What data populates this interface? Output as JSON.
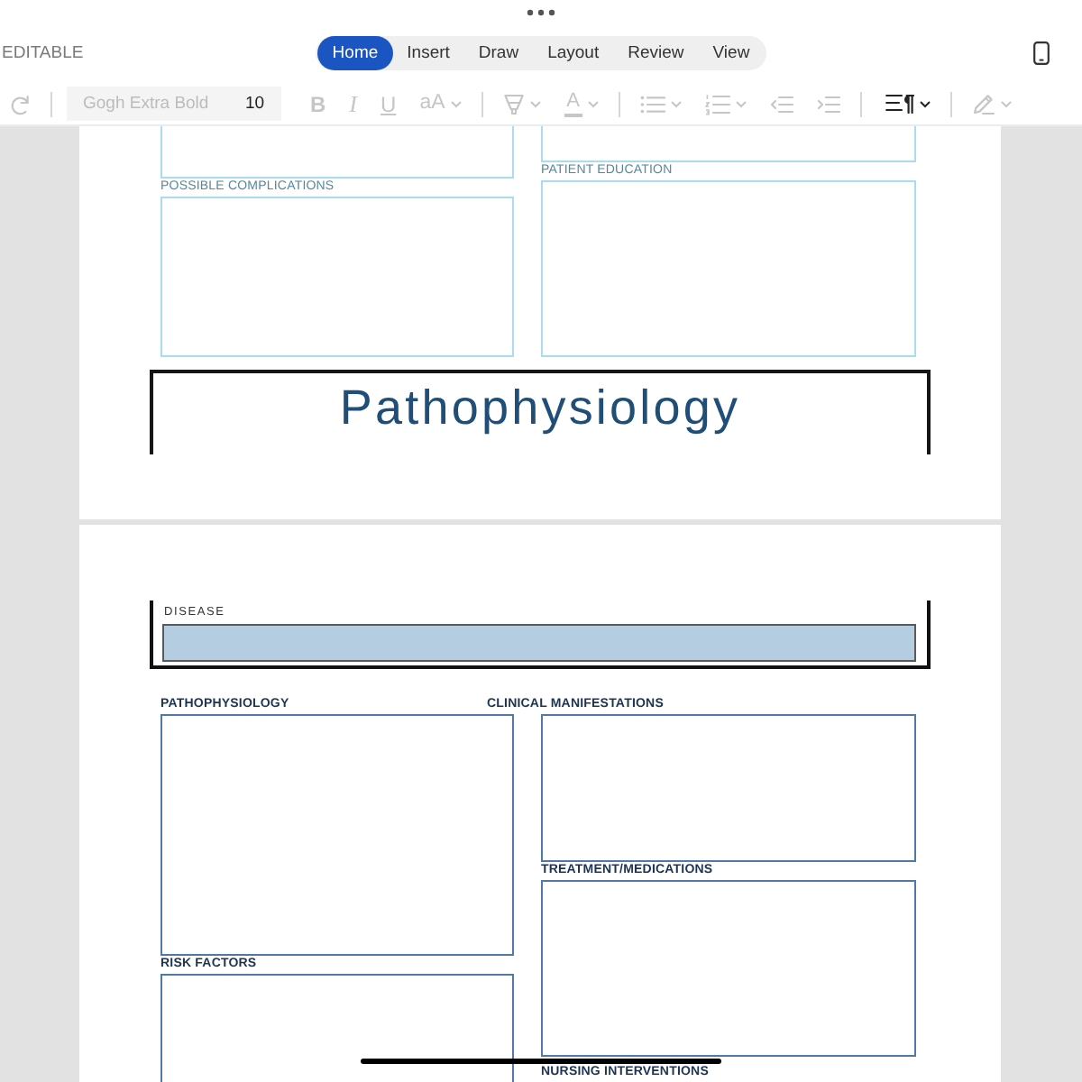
{
  "status": {
    "label": "EDITABLE"
  },
  "tabs": [
    {
      "label": "Home",
      "selected": true
    },
    {
      "label": "Insert",
      "selected": false
    },
    {
      "label": "Draw",
      "selected": false
    },
    {
      "label": "Layout",
      "selected": false
    },
    {
      "label": "Review",
      "selected": false
    },
    {
      "label": "View",
      "selected": false
    }
  ],
  "toolbar": {
    "groups": [
      {
        "items": [
          {
            "kind": "redo",
            "disabled": true
          }
        ]
      },
      {
        "items": [
          {
            "kind": "font",
            "value": "Gogh Extra Bold",
            "disabled": true
          },
          {
            "kind": "size",
            "value": "10",
            "disabled": false
          },
          {
            "kind": "bold",
            "label": "B",
            "disabled": true
          },
          {
            "kind": "italic",
            "label": "I",
            "disabled": true
          },
          {
            "kind": "underline",
            "label": "U",
            "disabled": true
          },
          {
            "kind": "text_size",
            "label": "aA",
            "disabled": true
          }
        ]
      },
      {
        "items": [
          {
            "kind": "highlight",
            "disabled": true
          },
          {
            "kind": "font_color",
            "label": "A",
            "disabled": true
          }
        ]
      },
      {
        "items": [
          {
            "kind": "bullets",
            "disabled": true
          },
          {
            "kind": "numbering",
            "disabled": true
          },
          {
            "kind": "outdent",
            "disabled": true
          },
          {
            "kind": "indent",
            "disabled": true
          }
        ]
      },
      {
        "items": [
          {
            "kind": "paragraph",
            "disabled": false
          }
        ]
      },
      {
        "items": [
          {
            "kind": "styles",
            "disabled": true
          }
        ]
      }
    ]
  },
  "page_1": {
    "columns": [
      {
        "items": [
          {
            "kind": "box"
          },
          {
            "kind": "field",
            "label": "POSSIBLE COMPLICATIONS"
          }
        ]
      },
      {
        "items": [
          {
            "kind": "box"
          },
          {
            "kind": "field",
            "label": "PATIENT EDUCATION"
          }
        ]
      }
    ],
    "title": "Pathophysiology"
  },
  "page_2": {
    "disease": {
      "label": "DISEASE"
    },
    "columns": [
      {
        "items": [
          {
            "kind": "field",
            "label": "PATHOPHYSIOLOGY"
          },
          {
            "kind": "field",
            "label": "RISK FACTORS"
          }
        ]
      },
      {
        "items": [
          {
            "kind": "field",
            "label": "CLINICAL MANIFESTATIONS"
          },
          {
            "kind": "field",
            "label": "TREATMENT/MEDICATIONS"
          },
          {
            "kind": "heading",
            "label": "NURSING INTERVENTIONS"
          }
        ]
      }
    ]
  }
}
